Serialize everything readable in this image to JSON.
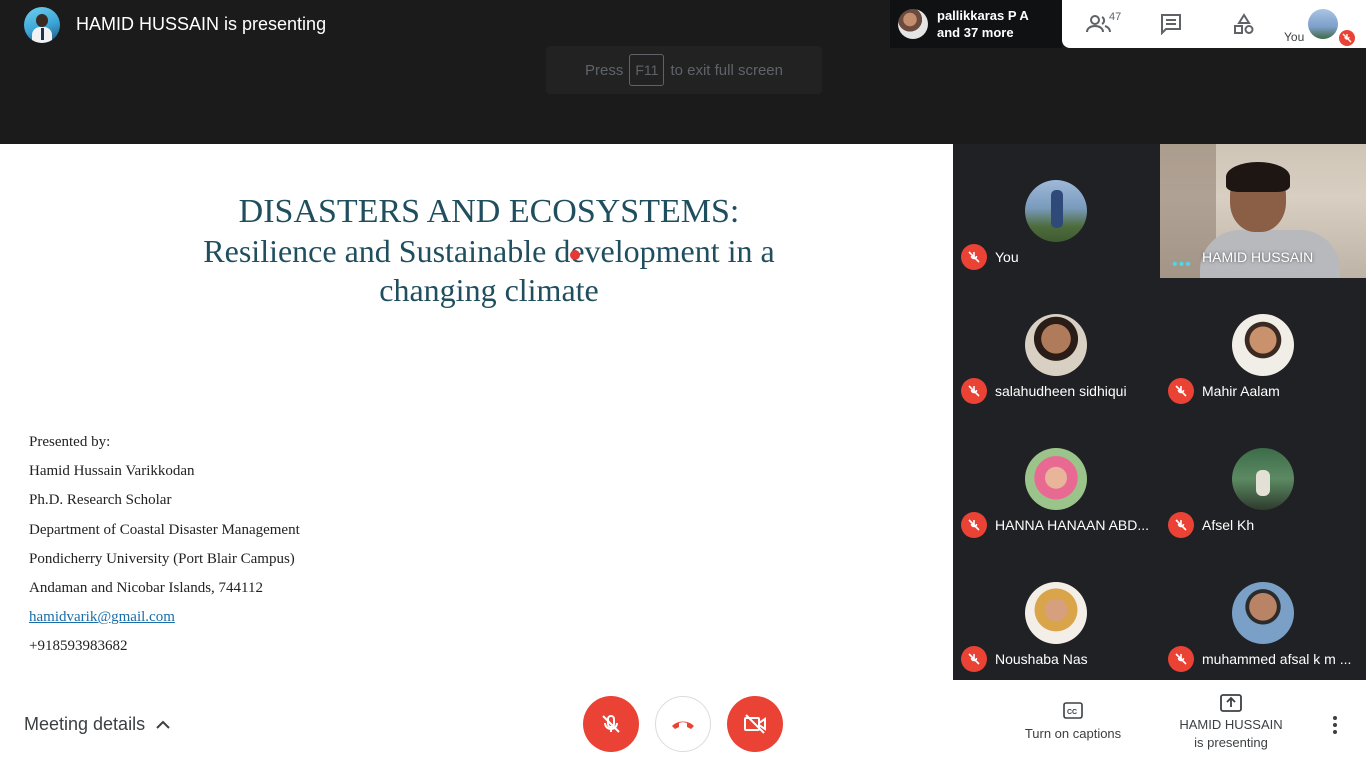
{
  "header": {
    "presenting_title": "HAMID HUSSAIN is presenting",
    "fullscreen_hint": {
      "before": "Press",
      "key": "F11",
      "after": "to exit full screen"
    },
    "participants_summary": {
      "line1": "pallikkaras P A",
      "line2": "and 37 more"
    },
    "people_count": "47",
    "self_label": "You"
  },
  "slide": {
    "title": "DISASTERS AND ECOSYSTEMS:",
    "subtitle": "Resilience and Sustainable development in a changing climate",
    "presenter_lines": [
      "Presented by:",
      "Hamid Hussain Varikkodan",
      "Ph.D. Research Scholar",
      "Department of Coastal Disaster Management",
      "Pondicherry University (Port Blair Campus)",
      "Andaman and Nicobar Islands, 744112",
      "hamidvarik@gmail.com",
      "+918593983682"
    ]
  },
  "participants": [
    {
      "name": "You",
      "muted": true
    },
    {
      "name": "HAMID HUSSAIN",
      "speaking": true
    },
    {
      "name": "salahudheen sidhiqui",
      "muted": true
    },
    {
      "name": "Mahir Aalam",
      "muted": true
    },
    {
      "name": "HANNA HANAAN ABD...",
      "muted": true
    },
    {
      "name": "Afsel Kh",
      "muted": true
    },
    {
      "name": "Noushaba Nas",
      "muted": true
    },
    {
      "name": "muhammed afsal k m ...",
      "muted": true
    }
  ],
  "footer": {
    "meeting_details": "Meeting details",
    "captions_label": "Turn on captions",
    "presenting_line1": "HAMID HUSSAIN",
    "presenting_line2": "is presenting"
  },
  "colors": {
    "accent_red": "#ea4335",
    "slide_title": "#1f4e5f",
    "speaking_dots": "#4fd6e3"
  },
  "icons": [
    "people-icon",
    "chat-icon",
    "activities-icon",
    "mic-off-icon",
    "hangup-icon",
    "camera-off-icon",
    "captions-icon",
    "present-icon",
    "more-vert-icon",
    "chevron-up-icon"
  ]
}
